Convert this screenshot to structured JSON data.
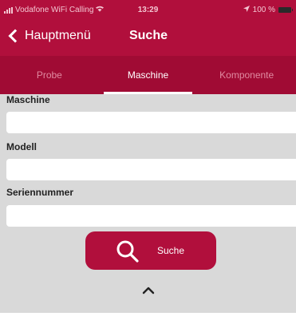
{
  "status_bar": {
    "carrier": "Vodafone WiFi Calling",
    "time": "13:29",
    "battery": "100 %"
  },
  "nav": {
    "back_label": "Hauptmenü",
    "title": "Suche"
  },
  "tabs": [
    {
      "label": "Probe",
      "active": false
    },
    {
      "label": "Maschine",
      "active": true
    },
    {
      "label": "Komponente",
      "active": false
    }
  ],
  "form": {
    "fields": [
      {
        "label": "Maschine",
        "value": "",
        "placeholder": ""
      },
      {
        "label": "Modell",
        "value": "",
        "placeholder": ""
      },
      {
        "label": "Seriennummer",
        "value": "",
        "placeholder": ""
      }
    ],
    "search_label": "Suche"
  },
  "colors": {
    "brand": "#b10f3c",
    "tab_bar": "#a00b34",
    "form_background": "#d9d9d9"
  },
  "icons": {
    "back": "chevron-left-icon",
    "search": "magnifier-icon",
    "collapse": "chevron-up-icon"
  }
}
